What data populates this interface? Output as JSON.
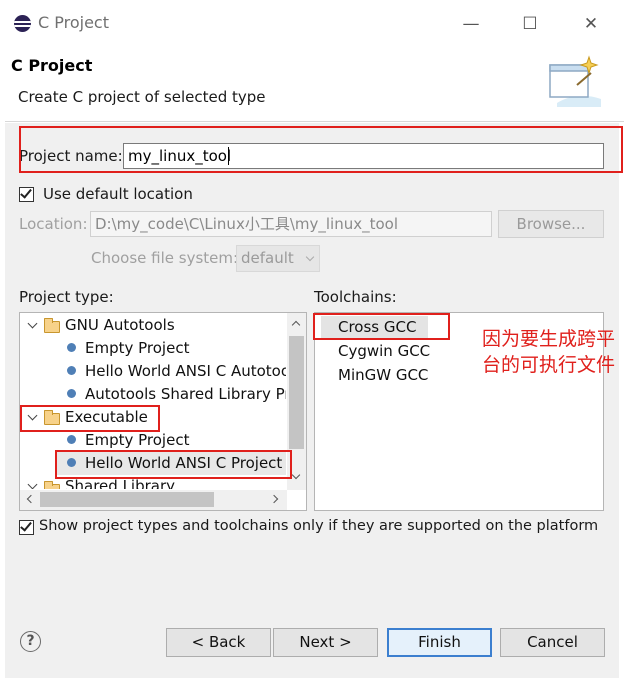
{
  "window": {
    "title": "C Project",
    "minimize_glyph": "—",
    "maximize_glyph": "☐",
    "close_glyph": "✕"
  },
  "header": {
    "title": "C Project",
    "description": "Create C project of selected type"
  },
  "project_name": {
    "label": "Project name:",
    "value": "my_linux_tool"
  },
  "use_default_location": {
    "label": "Use default location",
    "checked": true
  },
  "location": {
    "label": "Location:",
    "value": "D:\\my_code\\C\\Linux小工具\\my_linux_tool",
    "browse_label": "Browse..."
  },
  "file_system": {
    "label": "Choose file system:",
    "value": "default"
  },
  "project_type": {
    "label": "Project type:",
    "items": [
      {
        "label": "GNU Autotools",
        "kind": "folder"
      },
      {
        "label": "Empty Project",
        "kind": "leaf"
      },
      {
        "label": "Hello World ANSI C Autotools Project",
        "kind": "leaf"
      },
      {
        "label": "Autotools Shared Library Project",
        "kind": "leaf"
      },
      {
        "label": "Executable",
        "kind": "folder"
      },
      {
        "label": "Empty Project",
        "kind": "leaf"
      },
      {
        "label": "Hello World ANSI C Project",
        "kind": "leaf",
        "selected": true
      },
      {
        "label": "Shared Library",
        "kind": "folder"
      }
    ]
  },
  "toolchains": {
    "label": "Toolchains:",
    "items": [
      "Cross GCC",
      "Cygwin GCC",
      "MinGW GCC"
    ],
    "selected": "Cross GCC"
  },
  "annotation": {
    "note": "因为要生成跨平台的可执行文件",
    "color": "#e0201c"
  },
  "show_supported": {
    "label": "Show project types and toolchains only if they are supported on the platform",
    "checked": true
  },
  "buttons": {
    "help": "?",
    "back": "< Back",
    "next": "Next >",
    "finish": "Finish",
    "cancel": "Cancel"
  }
}
